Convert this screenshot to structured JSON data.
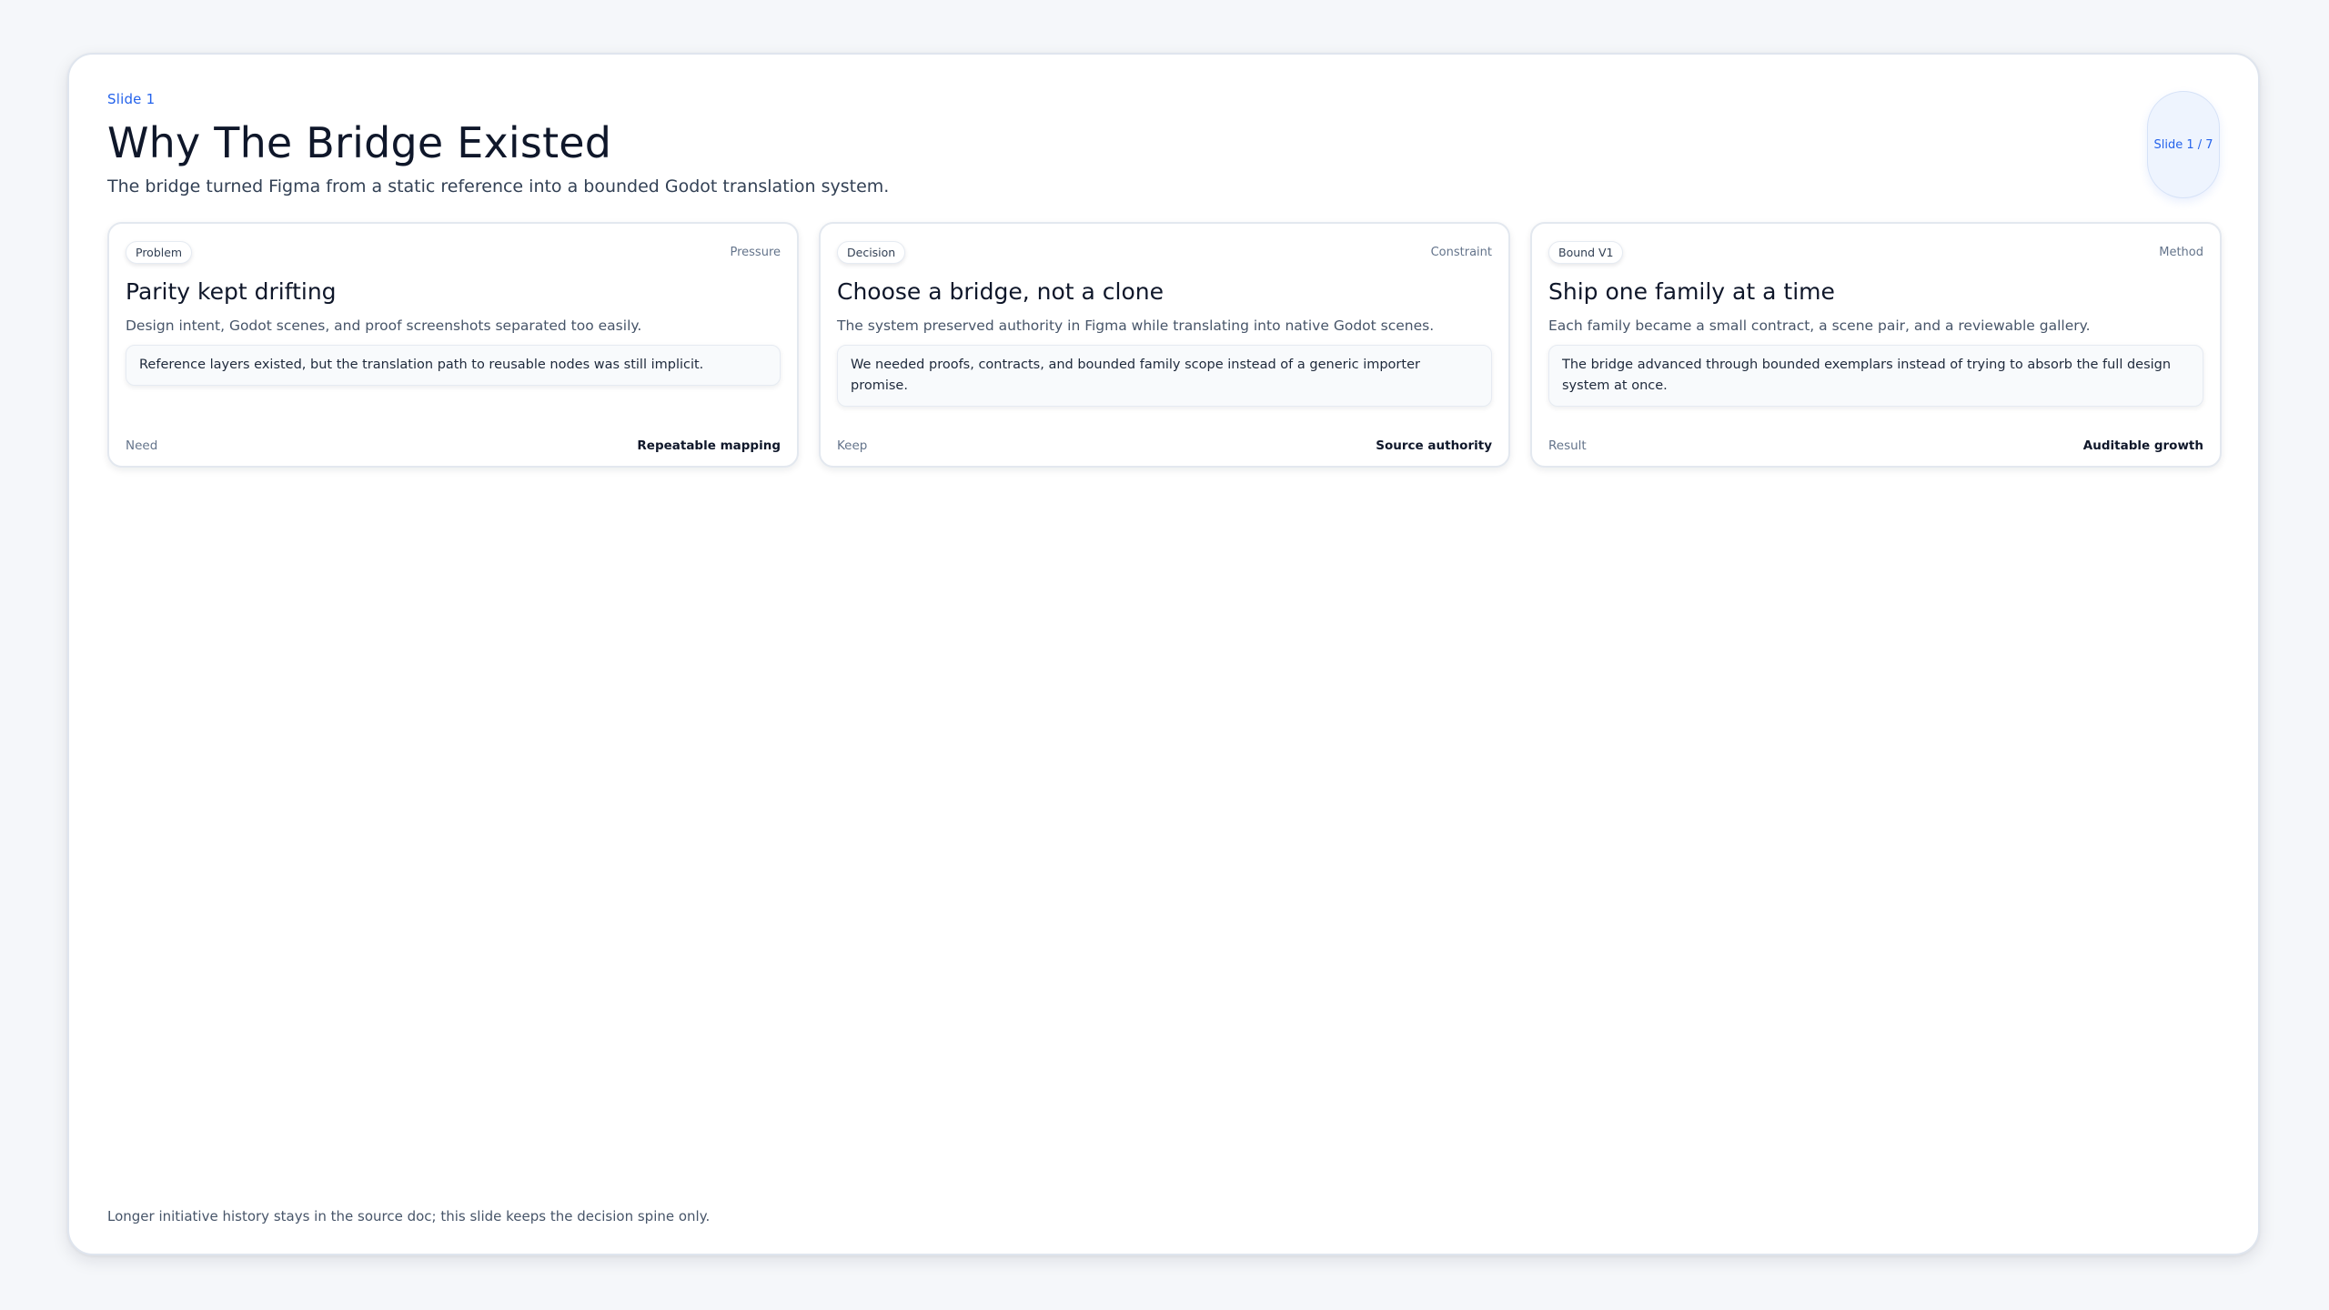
{
  "slide": {
    "eyebrow": "Slide 1",
    "title": "Why The Bridge Existed",
    "subtitle": "The bridge turned Figma from a static reference into a bounded Godot translation system.",
    "counter": "Slide 1 / 7",
    "footer": "Longer initiative history stays in the source doc; this slide keeps the decision spine only."
  },
  "cards": [
    {
      "tag": "Problem",
      "kind": "Pressure",
      "title": "Parity kept drifting",
      "description": "Design intent, Godot scenes, and proof screenshots separated too easily.",
      "note": "Reference layers existed, but the translation path to reusable nodes was still implicit.",
      "footer_label": "Need",
      "footer_value": "Repeatable mapping"
    },
    {
      "tag": "Decision",
      "kind": "Constraint",
      "title": "Choose a bridge, not a clone",
      "description": "The system preserved authority in Figma while translating into native Godot scenes.",
      "note": "We needed proofs, contracts, and bounded family scope instead of a generic importer promise.",
      "footer_label": "Keep",
      "footer_value": "Source authority"
    },
    {
      "tag": "Bound V1",
      "kind": "Method",
      "title": "Ship one family at a time",
      "description": "Each family became a small contract, a scene pair, and a reviewable gallery.",
      "note": "The bridge advanced through bounded exemplars instead of trying to absorb the full design system at once.",
      "footer_label": "Result",
      "footer_value": "Auditable growth"
    }
  ],
  "colors": {
    "accent": "#2563eb",
    "page_background": "#f5f7fa",
    "card_background": "#ffffff",
    "text_primary": "#0f172a",
    "text_muted": "#64748b"
  }
}
